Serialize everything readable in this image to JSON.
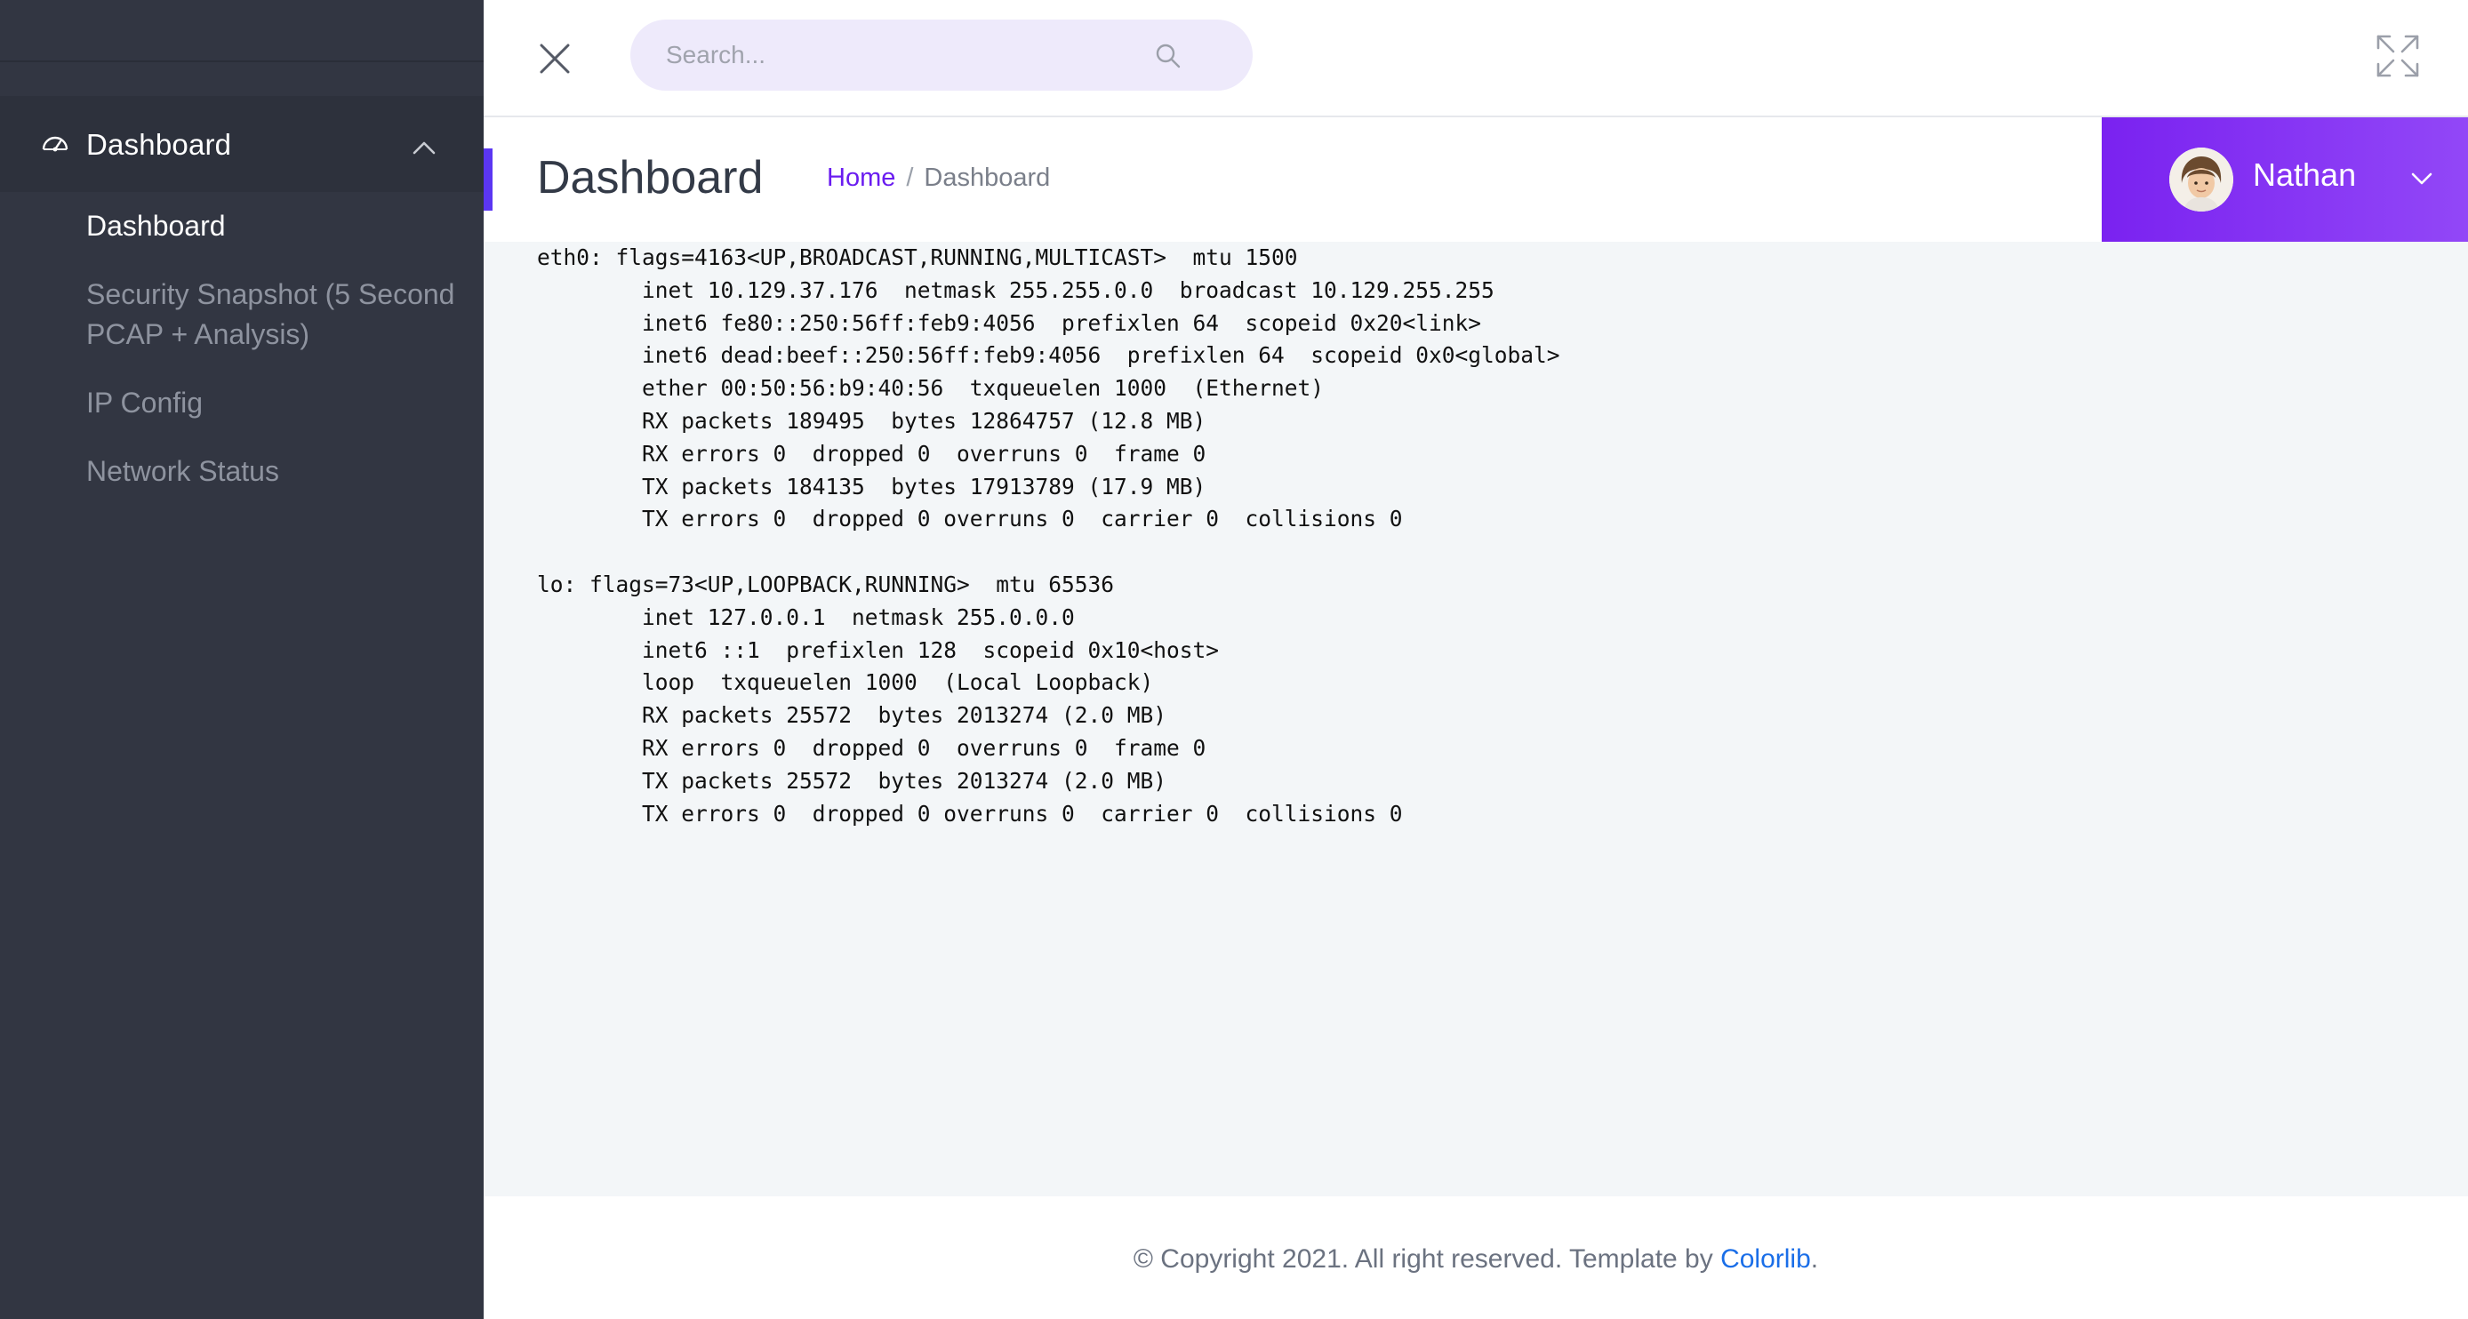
{
  "sidebar": {
    "menu_group": {
      "label": "Dashboard",
      "icon": "dashboard-gauge-icon"
    },
    "items": [
      {
        "label": "Dashboard",
        "active": true
      },
      {
        "label": "Security Snapshot (5 Second PCAP + Analysis)",
        "active": false
      },
      {
        "label": "IP Config",
        "active": false
      },
      {
        "label": "Network Status",
        "active": false
      }
    ]
  },
  "topbar": {
    "search_placeholder": "Search...",
    "close_icon": "close-icon",
    "search_icon": "search-icon",
    "expand_icon": "fullscreen-icon"
  },
  "header": {
    "title": "Dashboard",
    "breadcrumb": {
      "home": "Home",
      "separator": "/",
      "current": "Dashboard"
    }
  },
  "user": {
    "name": "Nathan"
  },
  "terminal_lines": [
    "eth0: flags=4163<UP,BROADCAST,RUNNING,MULTICAST>  mtu 1500",
    "        inet 10.129.37.176  netmask 255.255.0.0  broadcast 10.129.255.255",
    "        inet6 fe80::250:56ff:feb9:4056  prefixlen 64  scopeid 0x20<link>",
    "        inet6 dead:beef::250:56ff:feb9:4056  prefixlen 64  scopeid 0x0<global>",
    "        ether 00:50:56:b9:40:56  txqueuelen 1000  (Ethernet)",
    "        RX packets 189495  bytes 12864757 (12.8 MB)",
    "        RX errors 0  dropped 0  overruns 0  frame 0",
    "        TX packets 184135  bytes 17913789 (17.9 MB)",
    "        TX errors 0  dropped 0 overruns 0  carrier 0  collisions 0",
    "",
    "lo: flags=73<UP,LOOPBACK,RUNNING>  mtu 65536",
    "        inet 127.0.0.1  netmask 255.0.0.0",
    "        inet6 ::1  prefixlen 128  scopeid 0x10<host>",
    "        loop  txqueuelen 1000  (Local Loopback)",
    "        RX packets 25572  bytes 2013274 (2.0 MB)",
    "        RX errors 0  dropped 0  overruns 0  frame 0",
    "        TX packets 25572  bytes 2013274 (2.0 MB)",
    "        TX errors 0  dropped 0 overruns 0  carrier 0  collisions 0"
  ],
  "footer": {
    "text": "© Copyright 2021. All right reserved. Template by ",
    "link": "Colorlib",
    "suffix": "."
  },
  "colors": {
    "sidebar_bg": "#323642",
    "accent": "#5b36f2",
    "user_gradient_start": "#7a22f0",
    "user_gradient_end": "#9247f7",
    "link": "#1a6ee8"
  }
}
